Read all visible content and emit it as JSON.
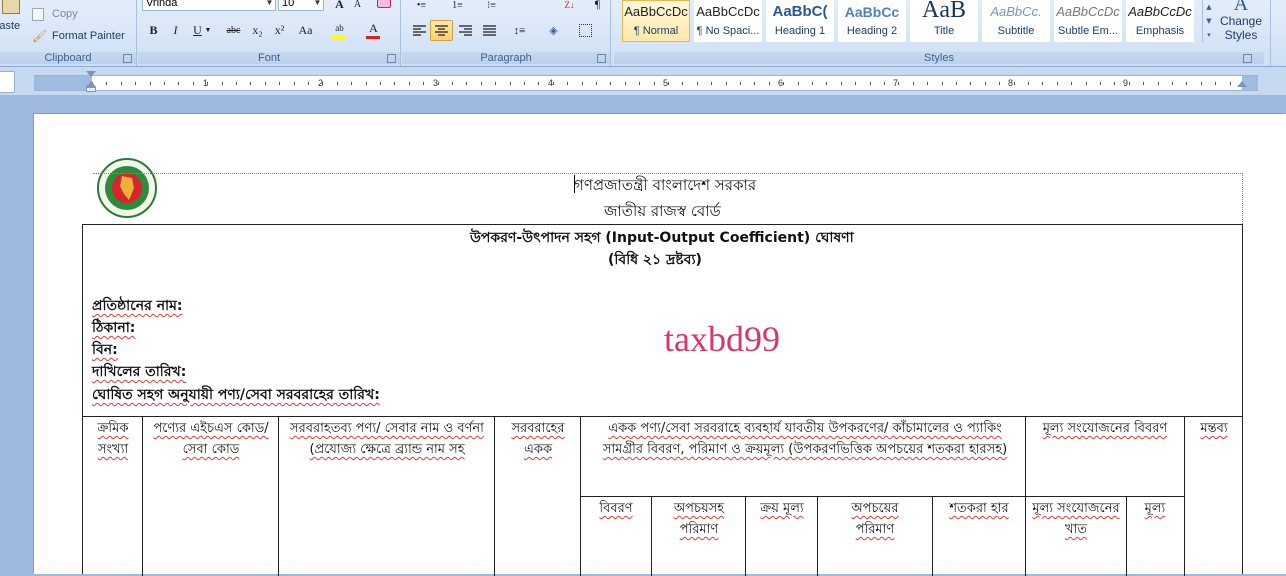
{
  "ribbon": {
    "clipboard": {
      "paste_label": "Paste",
      "copy_label": "Copy",
      "format_painter_label": "Format Painter",
      "group_label": "Clipboard"
    },
    "font": {
      "font_name": "Vrinda",
      "font_size": "10",
      "group_label": "Font",
      "bold": "B",
      "italic": "I",
      "underline": "U",
      "strikethrough": "abc",
      "subscript": "x₂",
      "superscript": "x²",
      "change_case": "Aa",
      "highlight": "ab",
      "font_color": "A",
      "grow": "A",
      "shrink": "A"
    },
    "paragraph": {
      "group_label": "Paragraph"
    },
    "styles": {
      "group_label": "Styles",
      "items": [
        {
          "sample": "AaBbCcDc",
          "name": "¶ Normal",
          "selected": true
        },
        {
          "sample": "AaBbCcDc",
          "name": "¶ No Spaci..."
        },
        {
          "sample": "AaBbC(",
          "name": "Heading 1"
        },
        {
          "sample": "AaBbCc",
          "name": "Heading 2"
        },
        {
          "sample": "AaB",
          "name": "Title"
        },
        {
          "sample": "AaBbCc.",
          "name": "Subtitle"
        },
        {
          "sample": "AaBbCcDc",
          "name": "Subtle Em..."
        },
        {
          "sample": "AaBbCcDc",
          "name": "Emphasis"
        }
      ],
      "change_styles_line1": "Change",
      "change_styles_line2": "Styles"
    }
  },
  "ruler": {
    "numbers": [
      "1",
      "2",
      "3",
      "4",
      "5",
      "6",
      "7",
      "8",
      "9"
    ]
  },
  "document": {
    "header_line1": "গণপ্রজাতন্ত্রী বাংলাদেশ সরকার",
    "header_line2": "জাতীয় রাজস্ব বোর্ড",
    "form_title": "উপকরণ-উৎপাদন সহগ (Input-Output Coefficient) ঘোষণা",
    "form_subtitle": "(বিধি ২১ দ্রষ্টব্য)",
    "watermark": "taxbd99",
    "fields": [
      "প্রতিষ্ঠানের নাম:",
      "ঠিকানা:",
      "বিন:",
      "দাখিলের তারিখ:",
      "ঘোষিত সহগ অনুযায়ী পণ্য/সেবা সরবরাহের তারিখ:"
    ],
    "table": {
      "col_serial": "ক্রমিক সংখ্যা",
      "col_hs_code": "পণ্যের এইচএস কোড/সেবা কোড",
      "col_name": "সরবরাহতব্য পণ্য/ সেবার নাম ও বর্ণনা (প্রযোজ্য ক্ষেত্রে ব্র্যান্ড নাম সহ",
      "col_unit": "সরবরাহের একক",
      "col_materials": "একক পণ্য/সেবা সরবরাহে ব্যবহার্য যাবতীয় উপকরণের/ কাঁচামালের ও প্যাকিং সামগ্রীর বিবরণ, পরিমাণ ও ক্রয়মূল্য (উপকরণভিত্তিক অপচয়ের শতকরা হারসহ)",
      "col_value_addition": "মূল্য সংযোজনের বিবরণ",
      "col_remarks": "মন্তব্য",
      "sub_description": "বিবরণ",
      "sub_quantity": "অপচয়সহ পরিমাণ",
      "sub_price": "ক্রয় মূল্য",
      "sub_wastage": "অপচয়ের পরিমাণ",
      "sub_percent": "শতকরা হার",
      "sub_va_sector": "মূল্য সংযোজনের খাত",
      "sub_value": "মূল্য"
    }
  },
  "colors": {
    "watermark": "#d9366b",
    "ribbon_label": "#3d5f93",
    "selected_style": "#ffe8a8"
  }
}
